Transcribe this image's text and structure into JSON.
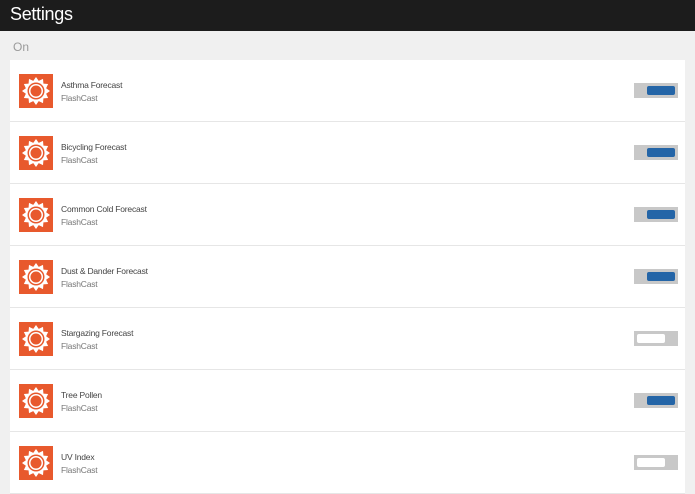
{
  "header": {
    "title": "Settings"
  },
  "section": {
    "label": "On"
  },
  "colors": {
    "icon_bg": "#e8592d",
    "toggle_on": "#2465a7",
    "toggle_track": "#c8c8c8",
    "header_bg": "#1c1c1c"
  },
  "items": [
    {
      "title": "Asthma Forecast",
      "subtitle": "FlashCast",
      "enabled": true,
      "icon": "sun-icon"
    },
    {
      "title": "Bicycling Forecast",
      "subtitle": "FlashCast",
      "enabled": true,
      "icon": "sun-icon"
    },
    {
      "title": "Common Cold Forecast",
      "subtitle": "FlashCast",
      "enabled": true,
      "icon": "sun-icon"
    },
    {
      "title": "Dust & Dander Forecast",
      "subtitle": "FlashCast",
      "enabled": true,
      "icon": "sun-icon"
    },
    {
      "title": "Stargazing Forecast",
      "subtitle": "FlashCast",
      "enabled": false,
      "icon": "sun-icon"
    },
    {
      "title": "Tree Pollen",
      "subtitle": "FlashCast",
      "enabled": true,
      "icon": "sun-icon"
    },
    {
      "title": "UV Index",
      "subtitle": "FlashCast",
      "enabled": false,
      "icon": "sun-icon"
    }
  ]
}
